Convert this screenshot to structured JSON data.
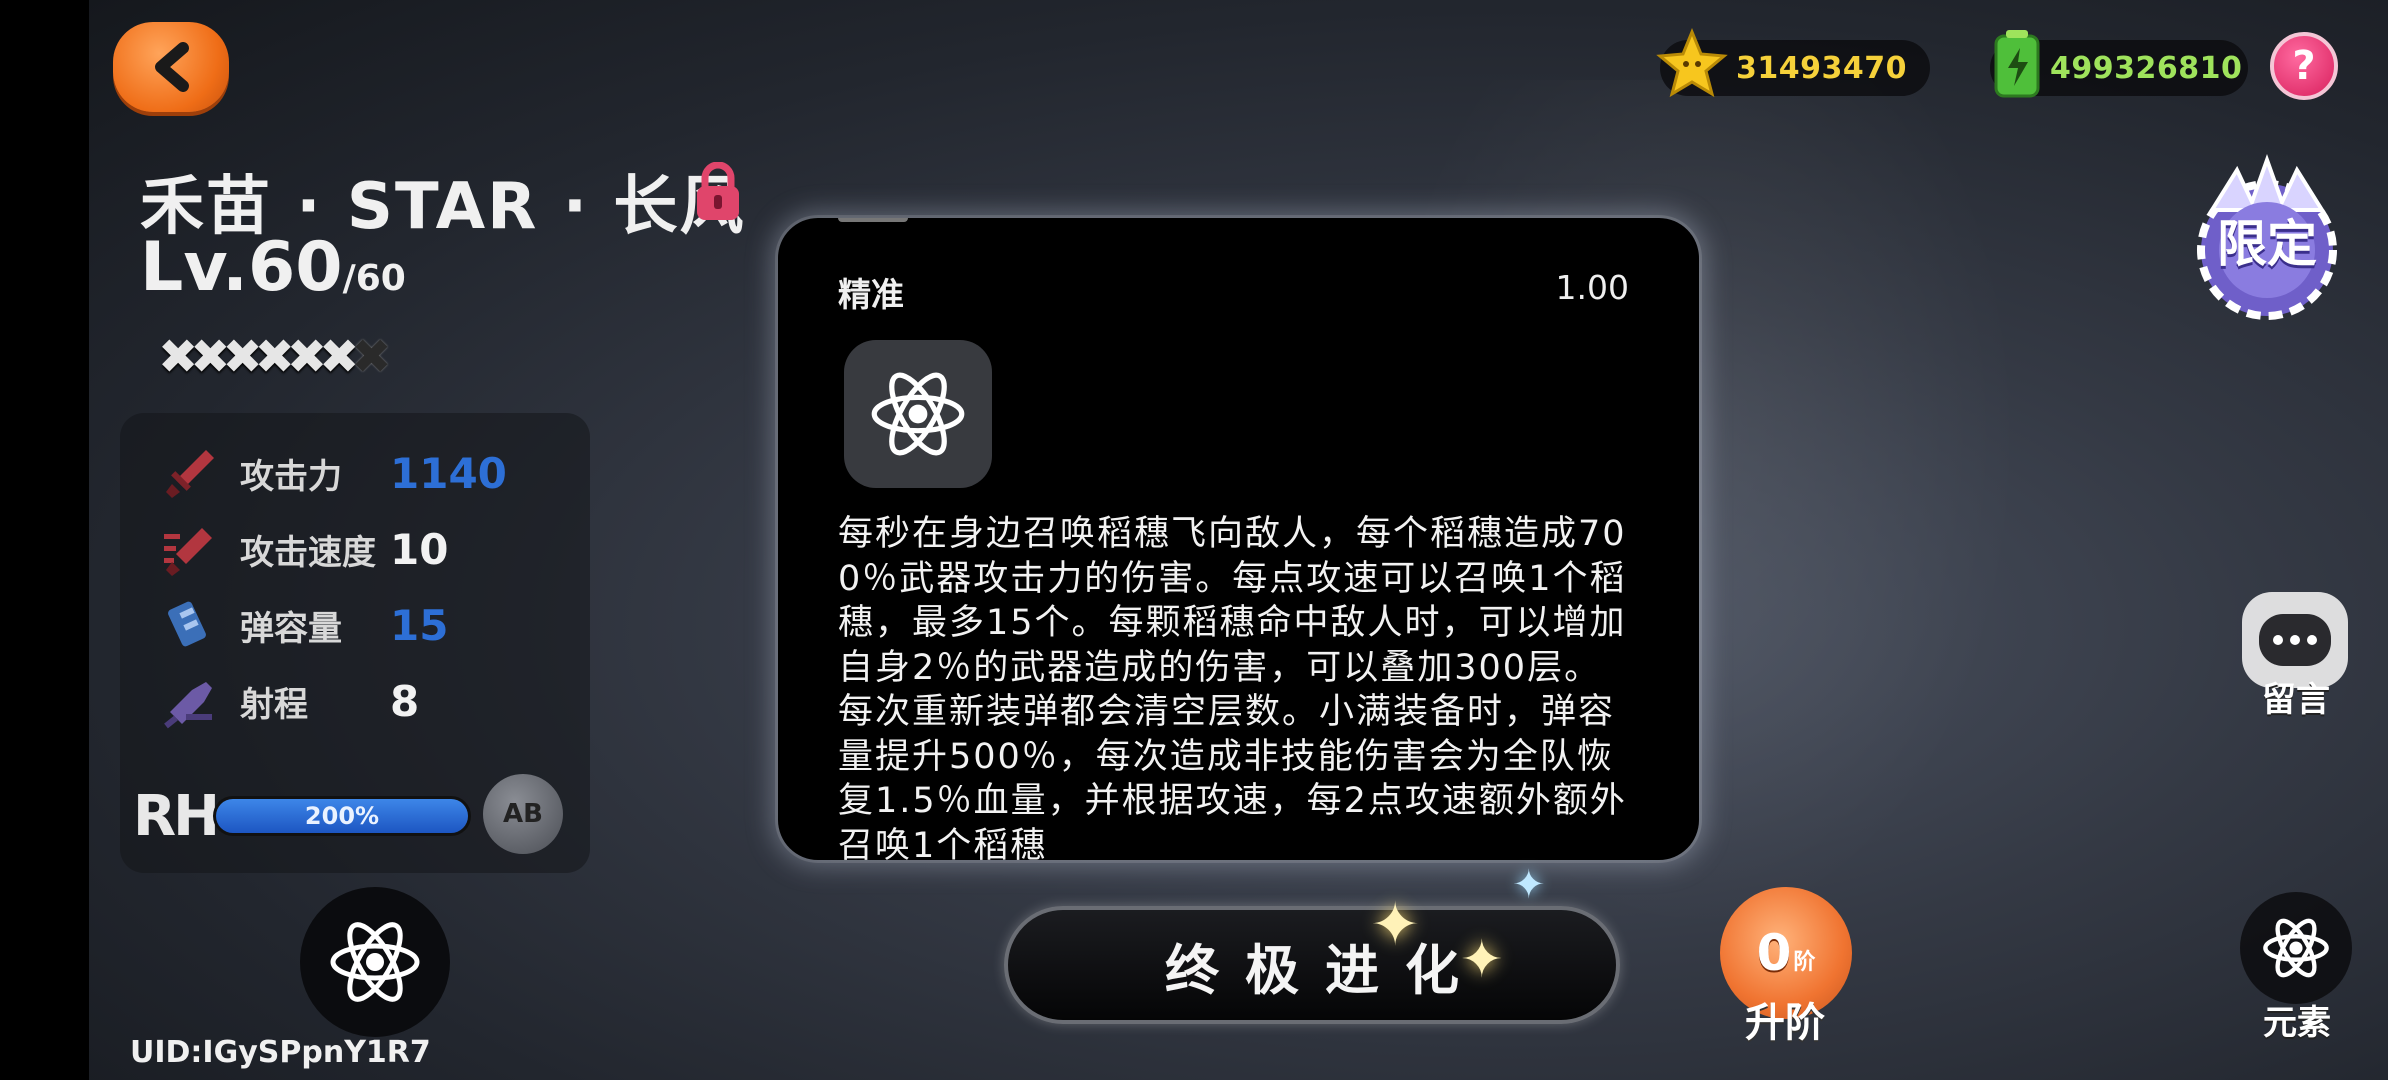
{
  "header": {
    "back_icon": "back-chevron-icon",
    "gold": {
      "icon": "star-coin-icon",
      "value": "31493470"
    },
    "energy": {
      "icon": "green-battery-icon",
      "value": "499326810"
    },
    "help": {
      "icon": "question-icon",
      "label": "?"
    }
  },
  "badge": {
    "label": "限定",
    "icon": "crown-badge-icon"
  },
  "character": {
    "name": "禾苗 · STAR · 长风",
    "level": "Lv.60",
    "level_max": "/60",
    "stars_filled": 6,
    "stars_total": 7,
    "stats": [
      {
        "label": "攻击力",
        "value": "1140",
        "icon": "sword-icon",
        "color": "#2d6fd6"
      },
      {
        "label": "攻击速度",
        "value": "10",
        "icon": "speed-sword-icon",
        "color": "#f2f2f2"
      },
      {
        "label": "弹容量",
        "value": "15",
        "icon": "magazine-icon",
        "color": "#2d6fd6"
      },
      {
        "label": "射程",
        "value": "8",
        "icon": "range-gun-icon",
        "color": "#f2f2f2"
      }
    ],
    "rh": {
      "label": "RH",
      "percent_text": "200%",
      "fill": 1.0
    },
    "swap_label": "AB",
    "element_icon": "atom-icon",
    "uid": "UID:IGySPpnY1R7"
  },
  "dialog": {
    "attr_label": "精准",
    "attr_value": "1.00",
    "skill_icon": "atom-icon",
    "description": "每秒在身边召唤稻穗飞向敌人，每个稻穗造成700％武器攻击力的伤害。每点攻速可以召唤1个稻穗，最多15个。每颗稻穗命中敌人时，可以增加自身2％的武器造成的伤害，可以叠加300层。每次重新装弹都会清空层数。小满装备时，弹容量提升500％，每次造成非技能伤害会为全队恢复1.5％血量，并根据攻速，每2点攻速额外额外召唤1个稻穗"
  },
  "bottom": {
    "evolve_label": "终极进化",
    "upgrade": {
      "value": "0",
      "unit": "阶",
      "label": "升阶"
    },
    "message_label": "留言",
    "element_label": "元素"
  }
}
